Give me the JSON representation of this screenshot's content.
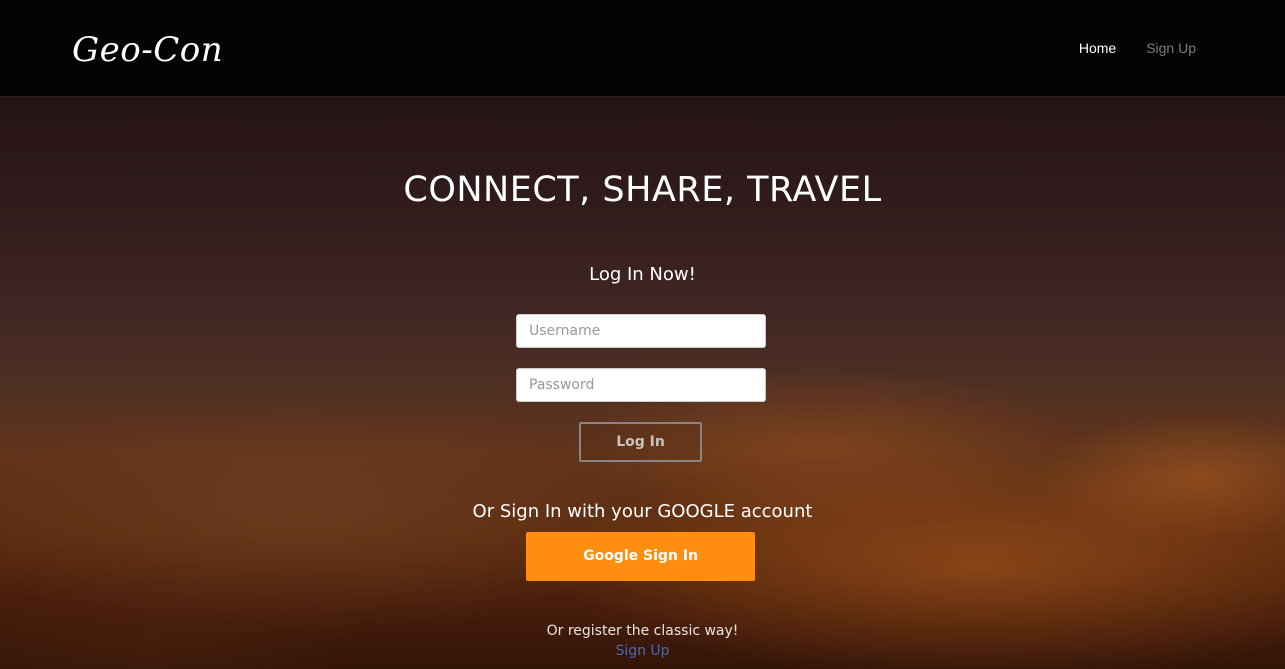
{
  "navbar": {
    "brand": "Geo-Con",
    "links": [
      {
        "label": "Home",
        "active": true
      },
      {
        "label": "Sign Up",
        "active": false
      }
    ]
  },
  "hero": {
    "headline": "CONNECT, SHARE, TRAVEL",
    "login_title": "Log In Now!",
    "username_placeholder": "Username",
    "password_placeholder": "Password",
    "login_button": "Log In",
    "google_text": "Or Sign In with your GOOGLE account",
    "google_button": "Google Sign In",
    "register_text": "Or register the classic way!",
    "register_link": "Sign Up"
  },
  "colors": {
    "navbar_bg": "#060304",
    "accent_orange": "#ff8d0f",
    "link_blue": "#4a6aa6",
    "nav_inactive": "#7d7d7d"
  }
}
